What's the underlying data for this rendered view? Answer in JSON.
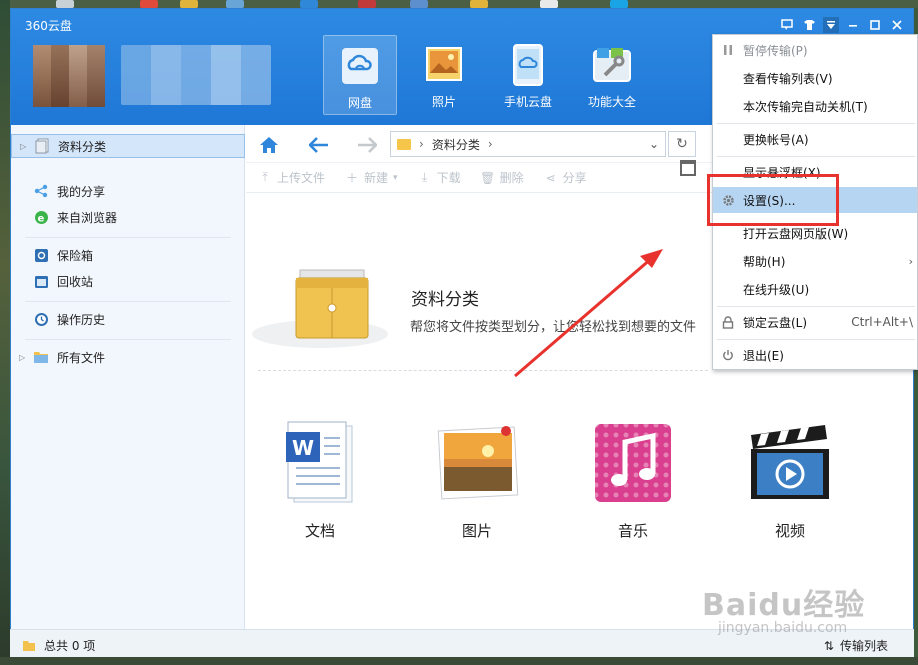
{
  "window": {
    "title": "360云盘"
  },
  "nav_tabs": [
    {
      "label": "网盘",
      "icon": "cloud-drive-icon",
      "active": true
    },
    {
      "label": "照片",
      "icon": "photo-icon",
      "active": false
    },
    {
      "label": "手机云盘",
      "icon": "phone-cloud-icon",
      "active": false
    },
    {
      "label": "功能大全",
      "icon": "toolbox-icon",
      "active": false
    }
  ],
  "title_controls": [
    "feedback-icon",
    "skin-icon",
    "menu-dropdown-icon",
    "minimize-icon",
    "maximize-icon",
    "close-icon"
  ],
  "sidebar": {
    "items": [
      {
        "label": "资料分类",
        "icon": "category-icon",
        "selected": true,
        "expandable": true
      },
      {
        "label": "我的分享",
        "icon": "share-icon"
      },
      {
        "label": "来自浏览器",
        "icon": "browser-icon"
      },
      {
        "label": "保险箱",
        "icon": "safe-icon"
      },
      {
        "label": "回收站",
        "icon": "recycle-bin-icon"
      },
      {
        "label": "操作历史",
        "icon": "history-icon"
      },
      {
        "label": "所有文件",
        "icon": "folder-icon",
        "expandable": true
      }
    ]
  },
  "path": {
    "crumb": "资料分类"
  },
  "toolbar": {
    "upload": "上传文件",
    "new": "新建",
    "download": "下载",
    "delete": "删除",
    "share": "分享"
  },
  "banner": {
    "title": "资料分类",
    "description": "帮您将文件按类型划分，让您轻松找到想要的文件"
  },
  "categories": [
    {
      "label": "文档",
      "icon": "document-icon"
    },
    {
      "label": "图片",
      "icon": "picture-icon"
    },
    {
      "label": "音乐",
      "icon": "music-icon"
    },
    {
      "label": "视频",
      "icon": "video-icon"
    }
  ],
  "status": {
    "total": "总共 0 项",
    "transfer_list": "传输列表"
  },
  "menu": {
    "items": [
      {
        "label": "暂停传输(P)",
        "disabled": true,
        "icon": "pause-icon"
      },
      {
        "label": "查看传输列表(V)"
      },
      {
        "label": "本次传输完自动关机(T)"
      },
      {
        "label": "更换帐号(A)"
      },
      {
        "label": "显示悬浮框(X)"
      },
      {
        "label": "设置(S)...",
        "icon": "gear-icon",
        "hover": true
      },
      {
        "label": "打开云盘网页版(W)"
      },
      {
        "label": "帮助(H)",
        "submenu": true
      },
      {
        "label": "在线升级(U)"
      },
      {
        "label": "锁定云盘(L)",
        "icon": "lock-icon",
        "shortcut": "Ctrl+Alt+\\"
      },
      {
        "label": "退出(E)",
        "icon": "power-icon"
      }
    ]
  },
  "watermark": {
    "main": "Baidu经验",
    "sub": "jingyan.baidu.com"
  },
  "colors": {
    "header_blue": "#1f77d6",
    "highlight_red": "#e8322d",
    "menu_hover": "#b6d5f3"
  }
}
